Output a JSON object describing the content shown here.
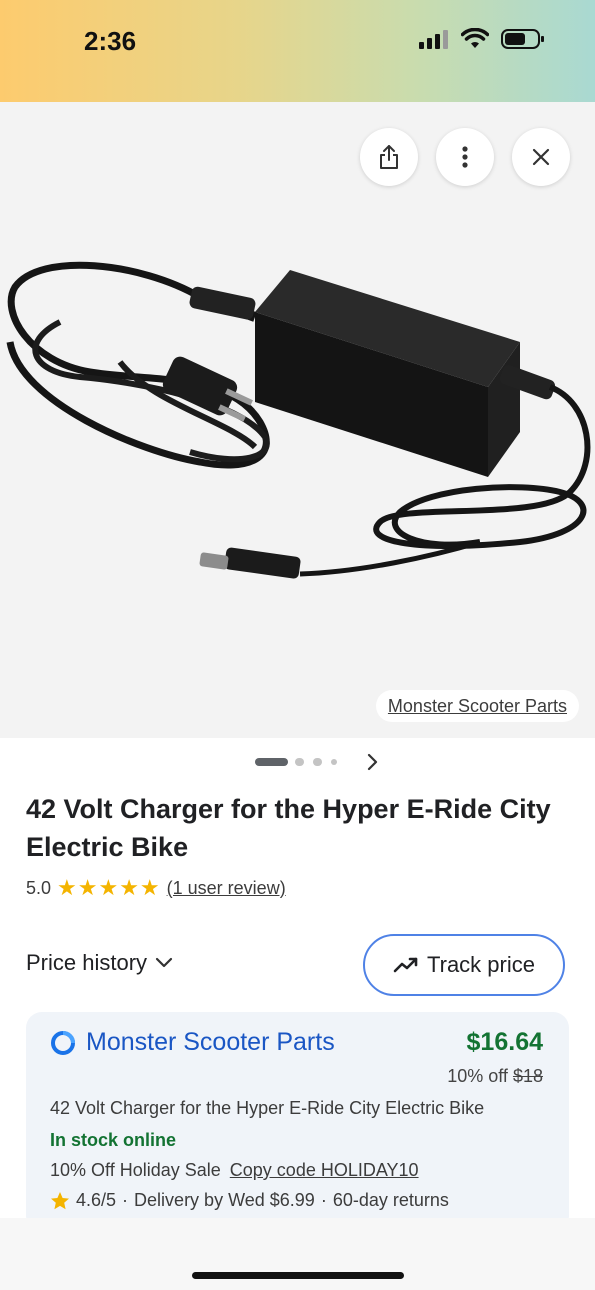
{
  "status_bar": {
    "time": "2:36",
    "icons": [
      "signal-icon",
      "wifi-icon",
      "battery-icon"
    ]
  },
  "hero": {
    "buttons": [
      "share-icon",
      "more-vert-icon",
      "close-icon"
    ],
    "source_label": "Monster Scooter Parts"
  },
  "carousel": {
    "active_index": 0,
    "dot_count": 4,
    "next_icon": "chevron-right-icon"
  },
  "product": {
    "title": "42 Volt Charger for the Hyper E-Ride City Electric Bike",
    "rating": "5.0",
    "stars": 5,
    "review_text": "(1 user review)"
  },
  "price_history": {
    "label": "Price history",
    "track_label": "Track price"
  },
  "offer": {
    "seller": "Monster Scooter Parts",
    "price": "$16.64",
    "discount_text": "10% off",
    "old_price": "$18",
    "title": "42 Volt Charger for the Hyper E-Ride City Electric Bike",
    "stock": "In stock online",
    "promo_text": "10% Off Holiday Sale",
    "promo_code": "Copy code HOLIDAY10",
    "store_rating": "4.6/5",
    "delivery": "Delivery by Wed $6.99",
    "returns": "60-day returns"
  },
  "colors": {
    "price_green": "#137333",
    "link_blue": "#1a56c4",
    "star_yellow": "#f4b400"
  }
}
